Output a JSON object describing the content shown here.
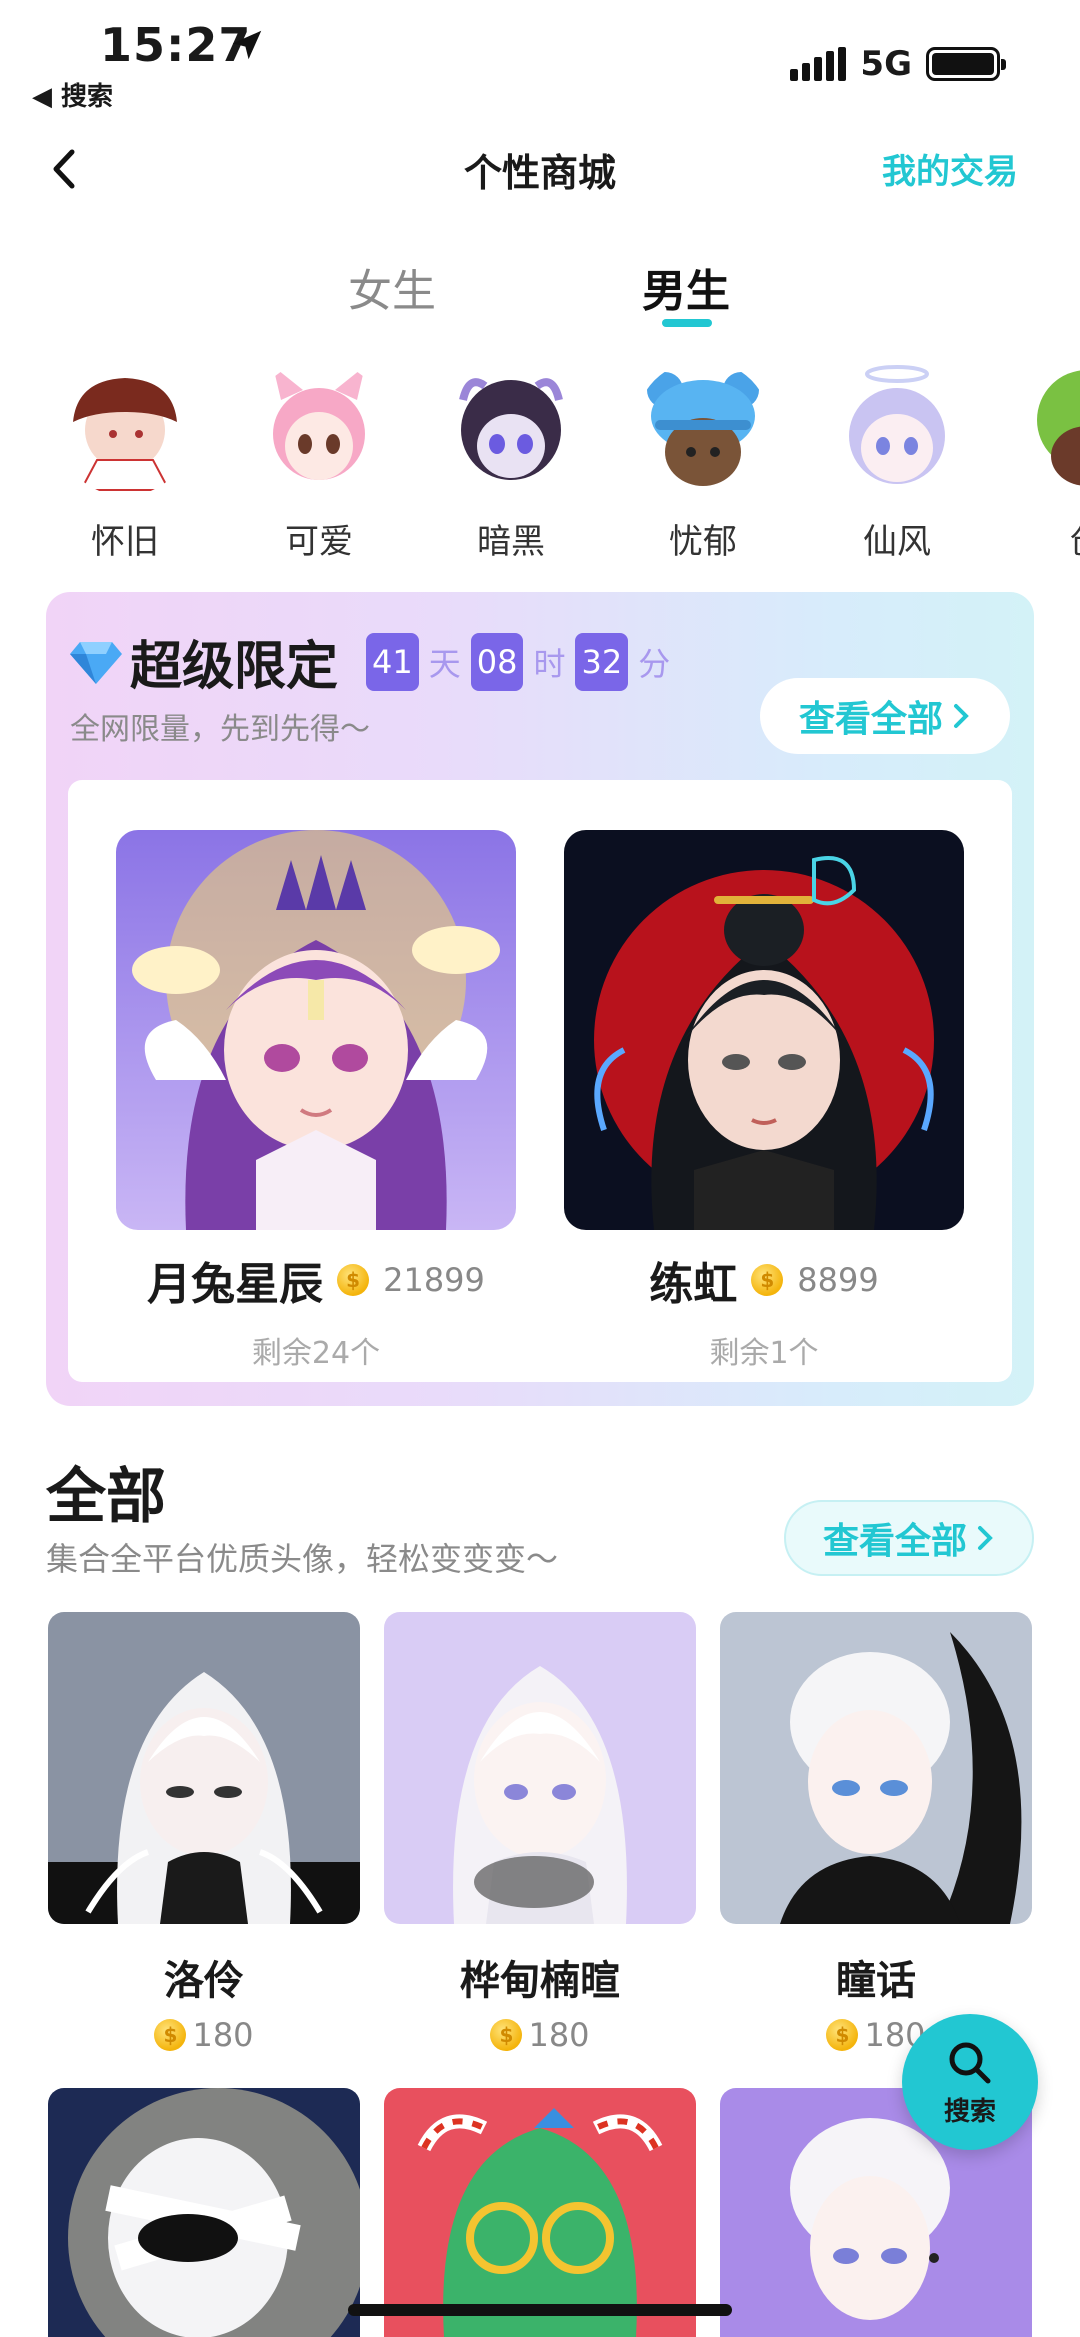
{
  "status_bar": {
    "time": "15:27",
    "back_app": "◀ 搜索",
    "network": "5G"
  },
  "nav": {
    "title": "个性商城",
    "right_link": "我的交易"
  },
  "gender_tabs": [
    {
      "label": "女生",
      "active": false
    },
    {
      "label": "男生",
      "active": true
    }
  ],
  "categories": [
    {
      "label": "怀旧",
      "icon": "avatar-nostalgia"
    },
    {
      "label": "可爱",
      "icon": "avatar-cute"
    },
    {
      "label": "暗黑",
      "icon": "avatar-dark"
    },
    {
      "label": "忧郁",
      "icon": "avatar-melancholy"
    },
    {
      "label": "仙风",
      "icon": "avatar-fairy"
    },
    {
      "label": "创",
      "icon": "avatar-creative"
    }
  ],
  "limited": {
    "title": "超级限定",
    "countdown": {
      "days": "41",
      "days_unit": "天",
      "hours": "08",
      "hours_unit": "时",
      "minutes": "32",
      "minutes_unit": "分"
    },
    "subtitle": "全网限量，先到先得～",
    "view_all": "查看全部",
    "items": [
      {
        "name": "月兔星辰",
        "price": "21899",
        "remain": "剩余24个"
      },
      {
        "name": "练虹",
        "price": "8899",
        "remain": "剩余1个"
      }
    ]
  },
  "all": {
    "title": "全部",
    "subtitle": "集合全平台优质头像，轻松变变变～",
    "view_all": "查看全部",
    "items": [
      {
        "name": "洛伶",
        "price": "180"
      },
      {
        "name": "桦甸楠暄",
        "price": "180"
      },
      {
        "name": "瞳话",
        "price": "180"
      }
    ]
  },
  "search_fab": {
    "label": "搜索"
  },
  "colors": {
    "accent": "#22c7d2",
    "countdown": "#7a66e8"
  }
}
